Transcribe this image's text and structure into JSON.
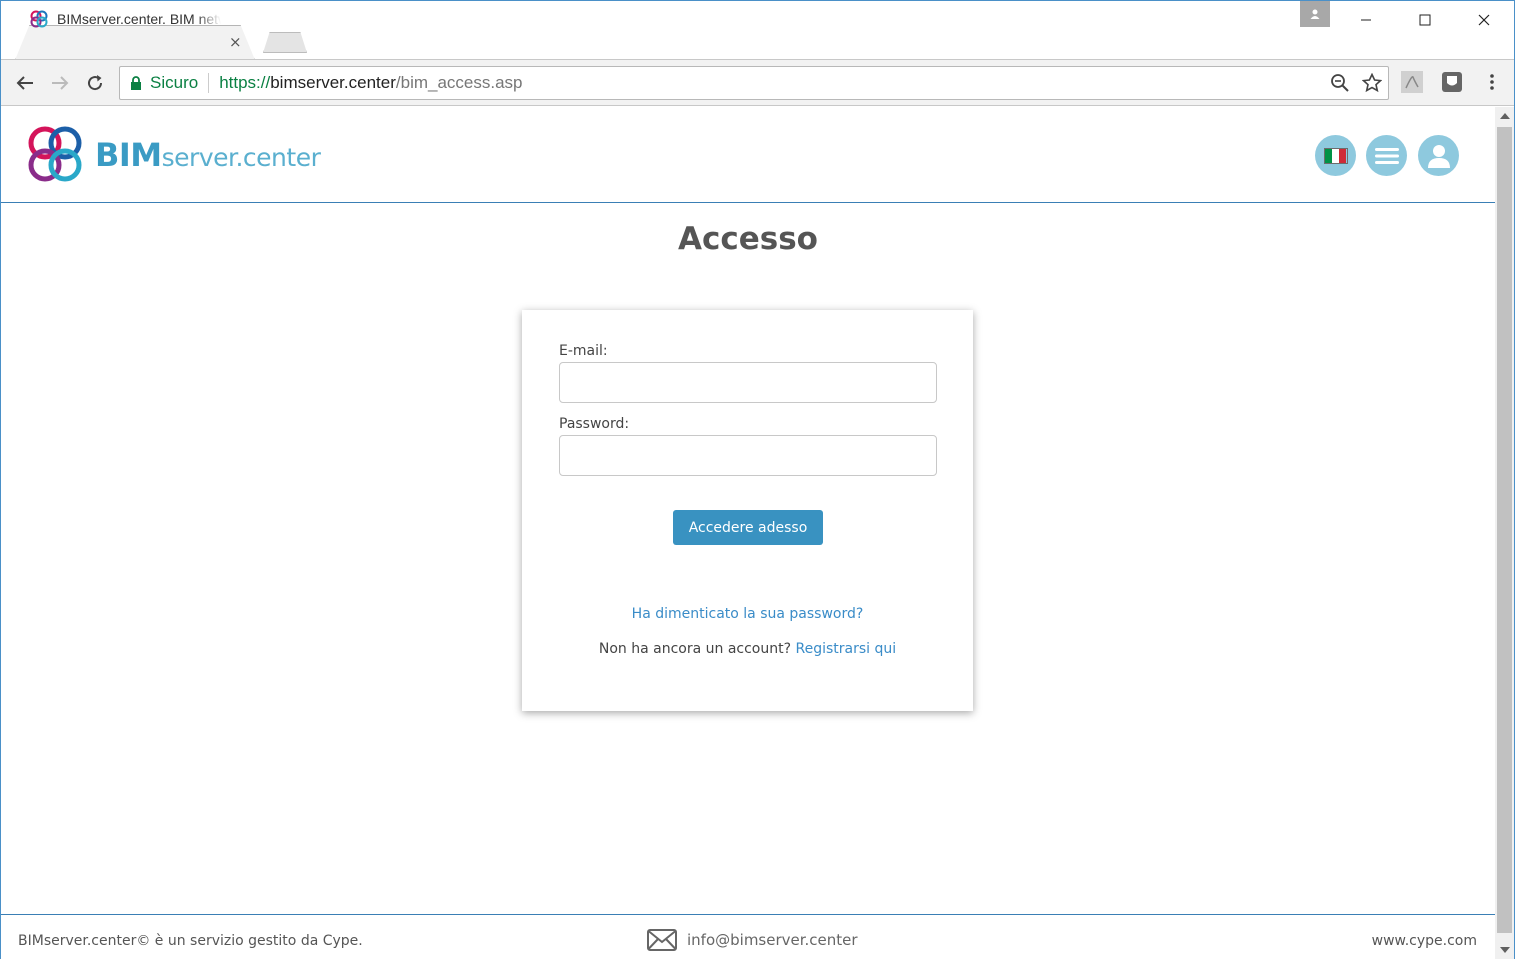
{
  "browser": {
    "tab_title": "BIMserver.center. BIM network",
    "tab_close": "×",
    "omnibox": {
      "secure_label": "Sicuro",
      "url_scheme": "https://",
      "url_host": "bimserver.center",
      "url_path": "/bim_access.asp"
    }
  },
  "site": {
    "logo_bim": "BIM",
    "logo_rest": "server.center",
    "flag_colors": [
      "#009246",
      "#ffffff",
      "#ce2b37"
    ]
  },
  "login": {
    "page_title": "Accesso",
    "email_label": "E-mail:",
    "email_value": "",
    "password_label": "Password:",
    "password_value": "",
    "submit_label": "Accedere adesso",
    "forgot_link": "Ha dimenticato la sua password?",
    "no_account_text": "Non ha ancora un account? ",
    "register_link": "Registrarsi qui"
  },
  "footer": {
    "copyright": "BIMserver.center© è un servizio gestito da Cype.",
    "email": "info@bimserver.center",
    "website": "www.cype.com"
  },
  "colors": {
    "accent": "#3992c1",
    "link": "#3a8cc8",
    "header_circle": "#8ec9de",
    "secure_green": "#0b8043"
  }
}
